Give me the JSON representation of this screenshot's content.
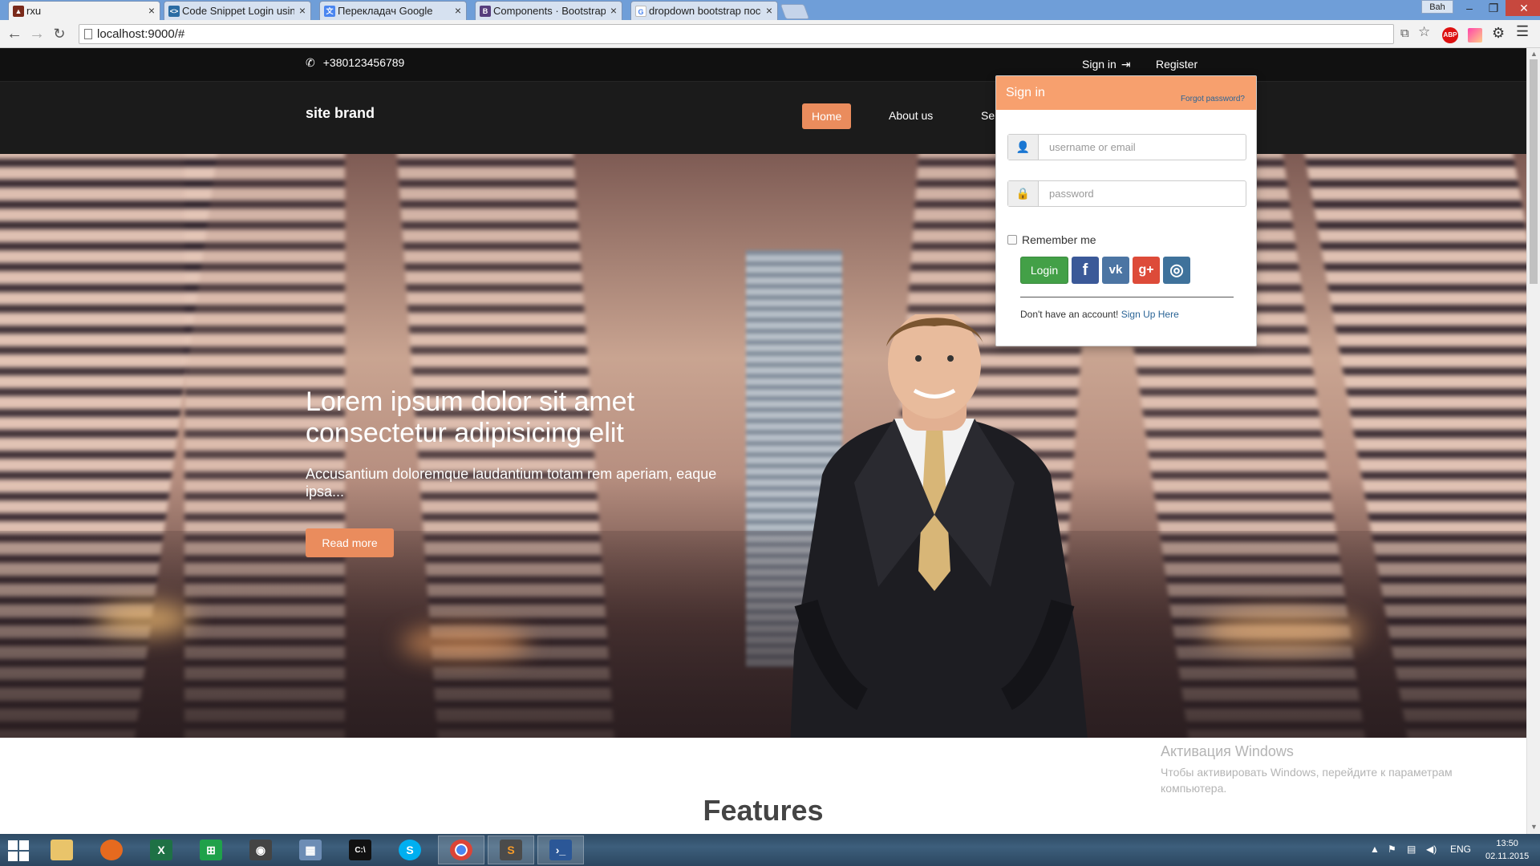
{
  "browser": {
    "tabs": [
      {
        "title": "rxu",
        "favicon": "rxu-favicon",
        "active": true
      },
      {
        "title": "Code Snippet Login using",
        "favicon": "code-snippet-favicon"
      },
      {
        "title": "Перекладач Google",
        "favicon": "google-translate-favicon"
      },
      {
        "title": "Components · Bootstrap",
        "favicon": "bootstrap-favicon"
      },
      {
        "title": "dropdown bootstrap посе",
        "favicon": "google-favicon"
      }
    ],
    "user_name": "Bah",
    "url": "localhost:9000/#",
    "tab_close": "×",
    "window_controls": {
      "minimize": "–",
      "restore": "❐",
      "close": "✕"
    },
    "extension_abp": "ABP"
  },
  "site": {
    "phone": "+380123456789",
    "signin_label": "Sign in",
    "register_label": "Register",
    "brand": "site brand",
    "nav": [
      "Home",
      "About us",
      "Se"
    ],
    "hero": {
      "title": "Lorem ipsum dolor sit amet consectetur adipisicing elit",
      "subtitle": "Accusantium doloremque laudantium totam rem aperiam, eaque ipsa...",
      "button": "Read more"
    },
    "features_heading": "Features"
  },
  "signin_dropdown": {
    "title": "Sign in",
    "forgot": "Forgot password?",
    "username_placeholder": "username or email",
    "password_placeholder": "password",
    "remember": "Remember me",
    "login_button": "Login",
    "social": [
      {
        "name": "facebook",
        "glyph": "f",
        "color": "#3b5998"
      },
      {
        "name": "vk",
        "glyph": "vk",
        "color": "#4c75a3"
      },
      {
        "name": "google-plus",
        "glyph": "g+",
        "color": "#dd4b39"
      },
      {
        "name": "instagram",
        "glyph": "◎",
        "color": "#3f729b"
      }
    ],
    "no_account": "Don't have an account!",
    "signup_link": "Sign Up Here"
  },
  "windows_watermark": {
    "title": "Активация Windows",
    "text": "Чтобы активировать Windows, перейдите к параметрам компьютера."
  },
  "taskbar": {
    "apps": [
      "file-explorer",
      "firefox",
      "excel",
      "store",
      "camera",
      "calculator",
      "cmd",
      "skype",
      "chrome",
      "sublime-text",
      "powershell"
    ],
    "language": "ENG",
    "time": "13:50",
    "date": "02.11.2015"
  },
  "colors": {
    "accent": "#ea8c5d",
    "dropdown_header": "#f7a06e",
    "login_green": "#43a047",
    "link": "#2a6496"
  }
}
